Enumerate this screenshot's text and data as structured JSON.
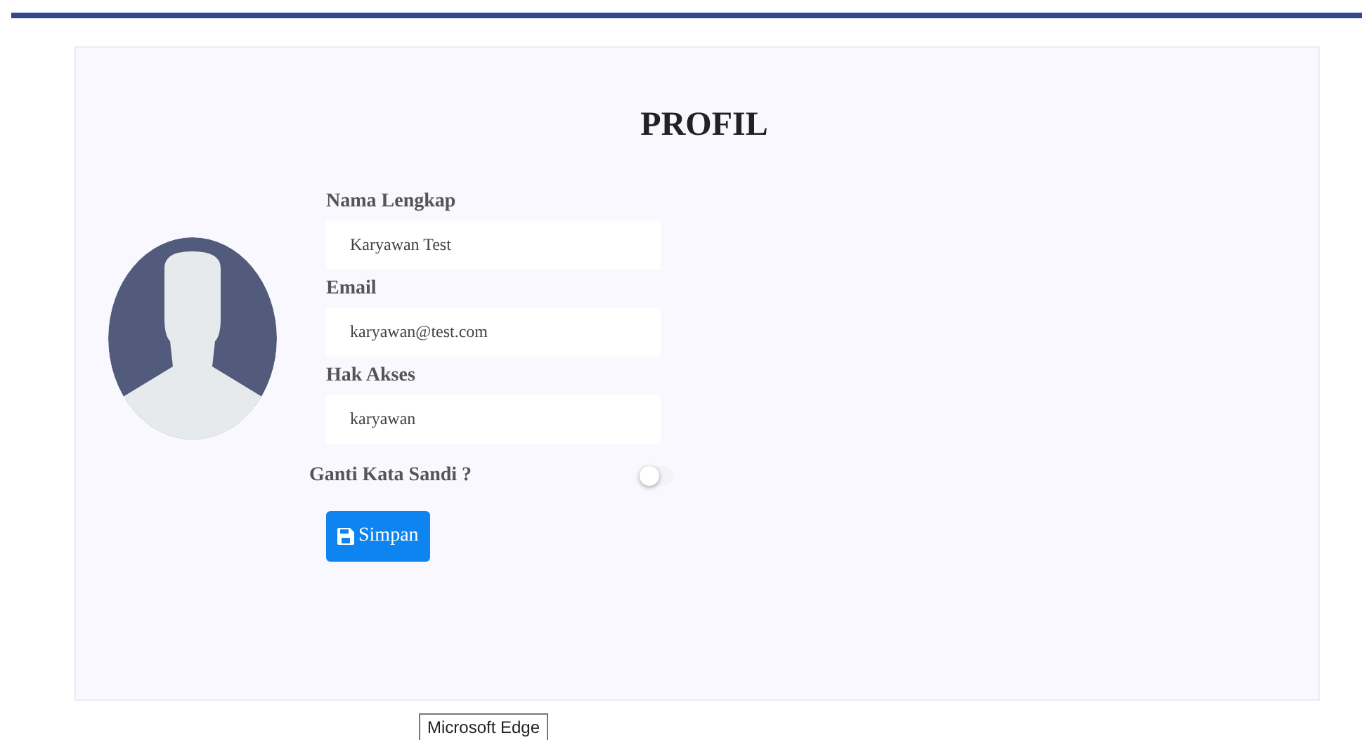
{
  "title": "PROFIL",
  "fields": [
    {
      "label": "Nama Lengkap",
      "value": "Karyawan Test"
    },
    {
      "label": "Email",
      "value": "karyawan@test.com"
    },
    {
      "label": "Hak Akses",
      "value": "karyawan"
    }
  ],
  "change_password": {
    "label": "Ganti Kata Sandi ?",
    "on": false
  },
  "save_button": "Simpan",
  "tooltip": "Microsoft Edge"
}
